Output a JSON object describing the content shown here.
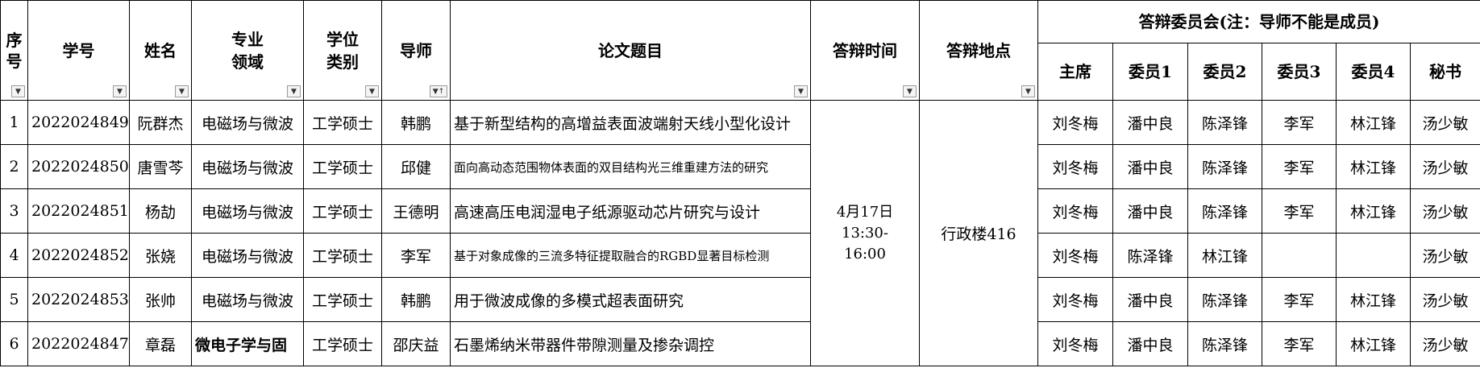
{
  "columns": {
    "index": "序号",
    "student_id": "学号",
    "name": "姓名",
    "field_line1": "专业",
    "field_line2": "领域",
    "degree_line1": "学位",
    "degree_line2": "类别",
    "advisor": "导师",
    "thesis": "论文题目",
    "time": "答辩时间",
    "location": "答辩地点",
    "committee": "答辩委员会(注：导师不能是成员)",
    "chair": "主席",
    "member1": "委员1",
    "member2": "委员2",
    "member3": "委员3",
    "member4": "委员4",
    "secretary": "秘书"
  },
  "icons": {
    "filter": "dropdown-filter-icon",
    "sort_filter": "sort-filter-icon"
  },
  "defense_time": "4月17日 13:30-16:00",
  "defense_location": "行政楼416",
  "rows": [
    {
      "index": "1",
      "student_id": "2022024849",
      "name": "阮群杰",
      "field": "电磁场与微波",
      "degree": "工学硕士",
      "advisor": "韩鹏",
      "thesis": "基于新型结构的高增益表面波端射天线小型化设计",
      "chair": "刘冬梅",
      "member1": "潘中良",
      "member2": "陈泽锋",
      "member3": "李军",
      "member4": "林江锋",
      "secretary": "汤少敏"
    },
    {
      "index": "2",
      "student_id": "2022024850",
      "name": "唐雪芩",
      "field": "电磁场与微波",
      "degree": "工学硕士",
      "advisor": "邱健",
      "thesis": "面向高动态范围物体表面的双目结构光三维重建方法的研究",
      "chair": "刘冬梅",
      "member1": "潘中良",
      "member2": "陈泽锋",
      "member3": "李军",
      "member4": "林江锋",
      "secretary": "汤少敏"
    },
    {
      "index": "3",
      "student_id": "2022024851",
      "name": "杨劼",
      "field": "电磁场与微波",
      "degree": "工学硕士",
      "advisor": "王德明",
      "thesis": "高速高压电润湿电子纸源驱动芯片研究与设计",
      "chair": "刘冬梅",
      "member1": "潘中良",
      "member2": "陈泽锋",
      "member3": "李军",
      "member4": "林江锋",
      "secretary": "汤少敏"
    },
    {
      "index": "4",
      "student_id": "2022024852",
      "name": "张娆",
      "field": "电磁场与微波",
      "degree": "工学硕士",
      "advisor": "李军",
      "thesis": "基于对象成像的三流多特征提取融合的RGBD显著目标检测",
      "chair": "刘冬梅",
      "member1": "陈泽锋",
      "member2": "林江锋",
      "member3": "",
      "member4": "",
      "secretary": "汤少敏"
    },
    {
      "index": "5",
      "student_id": "2022024853",
      "name": "张帅",
      "field": "电磁场与微波",
      "degree": "工学硕士",
      "advisor": "韩鹏",
      "thesis": "用于微波成像的多模式超表面研究",
      "chair": "刘冬梅",
      "member1": "潘中良",
      "member2": "陈泽锋",
      "member3": "李军",
      "member4": "林江锋",
      "secretary": "汤少敏"
    },
    {
      "index": "6",
      "student_id": "2022024847",
      "name": "章磊",
      "field": "微电子学与固",
      "degree": "工学硕士",
      "advisor": "邵庆益",
      "thesis": "石墨烯纳米带器件带隙测量及掺杂调控",
      "chair": "刘冬梅",
      "member1": "潘中良",
      "member2": "陈泽锋",
      "member3": "李军",
      "member4": "林江锋",
      "secretary": "汤少敏"
    }
  ]
}
